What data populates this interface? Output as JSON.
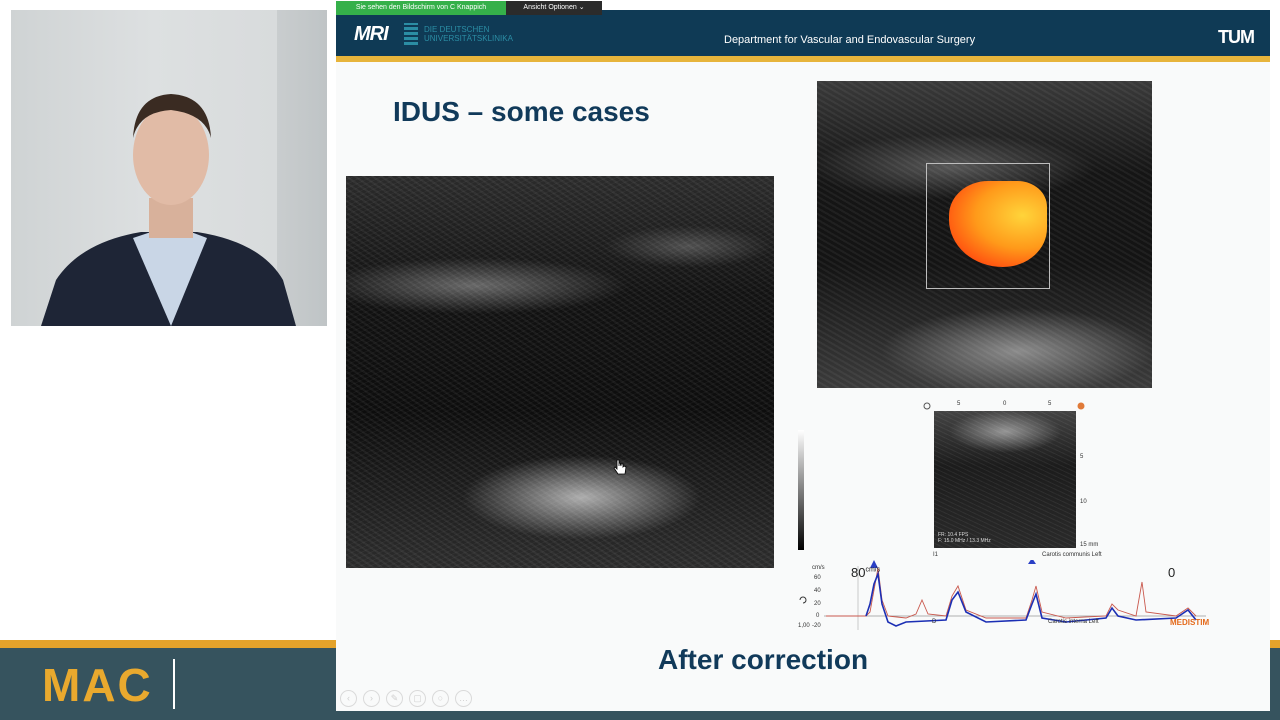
{
  "zoom": {
    "share_banner": "Sie sehen den Bildschirm von C Knappich",
    "view_options": "Ansicht Optionen"
  },
  "sidebar": {
    "brand": "MAC"
  },
  "slide": {
    "header": {
      "logo_mri": "MRI",
      "logo_university": "DIE DEUTSCHEN UNIVERSITÄTSKLINIKA",
      "department": "Department for Vascular and Endovascular Surgery",
      "logo_tum": "TUM"
    },
    "title": "IDUS – some cases",
    "caption": "After correction",
    "doppler_panel": {
      "scale_top": [
        "5",
        "0",
        "5"
      ],
      "scale_right": [
        "5",
        "10",
        "15 mm"
      ],
      "info_line1": "FR: 10.4 FPS",
      "info_line2": "F: 15.0 MHz / 13.3 MHz",
      "label_i1": "I1",
      "label_carotis_communis": "Carotis communis Left",
      "label_carotis_interna": "Carotis interna Left",
      "label_d": "D",
      "velocity_max": "80",
      "velocity_unit": "cm/s",
      "velocity_zero": "0",
      "scale_unit": "cm/s",
      "scale_ticks": [
        "60",
        "40",
        "20",
        "0",
        "-20"
      ],
      "scale_bottom": "1,00",
      "brand": "MEDISTIM"
    }
  },
  "toolbar_icons": [
    "prev-icon",
    "next-icon",
    "pen-icon",
    "copy-icon",
    "zoom-icon",
    "more-icon"
  ]
}
